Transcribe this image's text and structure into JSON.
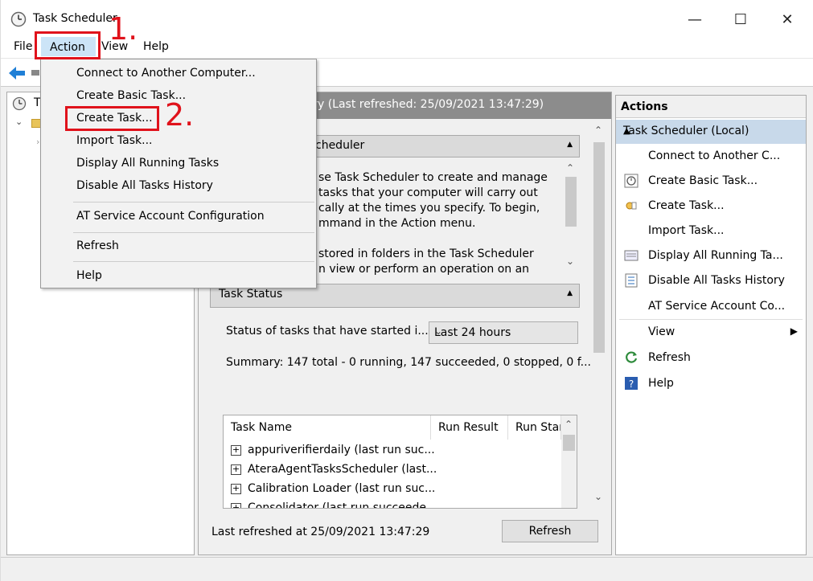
{
  "window": {
    "title": "Task Scheduler",
    "minimize": "—",
    "maximize": "☐",
    "close": "✕"
  },
  "menubar": {
    "file": "File",
    "action": "Action",
    "view": "View",
    "help": "Help"
  },
  "tree": {
    "root_label": "T"
  },
  "center": {
    "header": "mary (Last refreshed: 25/09/2021 13:47:29)",
    "overview_title": "cheduler",
    "overview_lines": [
      "se Task Scheduler to create and manage",
      "tasks that your computer will carry out",
      "cally at the times you specify. To begin,",
      "mmand in the Action menu.",
      "",
      "stored in folders in the Task Scheduler",
      "n view or perform an operation on an"
    ],
    "status_title": "Task Status",
    "status_label": "Status of tasks that have started i...",
    "status_select": "Last 24 hours",
    "summary": "Summary: 147 total - 0 running, 147 succeeded, 0 stopped, 0 f...",
    "table": {
      "headers": [
        "Task Name",
        "Run Result",
        "Run Star"
      ],
      "rows": [
        "appuriverifierdaily (last run suc...",
        "AteraAgentTasksScheduler (last...",
        "Calibration Loader (last run suc...",
        "Consolidator (last run succeede..."
      ]
    },
    "last_refreshed": "Last refreshed at 25/09/2021 13:47:29",
    "refresh_button": "Refresh"
  },
  "actions": {
    "title": "Actions",
    "group": "Task Scheduler (Local)",
    "items": [
      "Connect to Another C...",
      "Create Basic Task...",
      "Create Task...",
      "Import Task...",
      "Display All Running Ta...",
      "Disable All Tasks History",
      "AT Service Account Co...",
      "View",
      "Refresh",
      "Help"
    ]
  },
  "dropdown": {
    "items": [
      "Connect to Another Computer...",
      "Create Basic Task...",
      "Create Task...",
      "Import Task...",
      "Display All Running Tasks",
      "Disable All Tasks History",
      "AT Service Account Configuration",
      "Refresh",
      "Help"
    ]
  },
  "annotations": {
    "step1": "1.",
    "step2": "2.",
    "color": "#e0121b"
  }
}
